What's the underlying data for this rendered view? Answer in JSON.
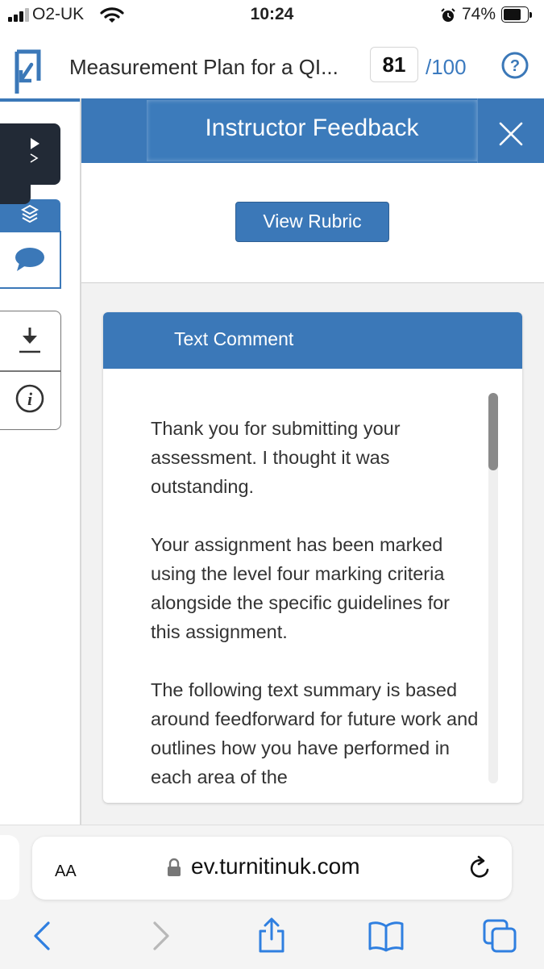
{
  "status_bar": {
    "carrier": "O2-UK",
    "time": "10:24",
    "battery_percent": "74%",
    "battery_level": 0.74,
    "icons": [
      "signal-icon",
      "wifi-icon",
      "alarm-icon",
      "battery-icon"
    ]
  },
  "header": {
    "title": "Measurement Plan for a QI...",
    "score": "81",
    "score_max": "/100",
    "icons": [
      "turnitin-logo-icon",
      "help-icon"
    ]
  },
  "sidebar": {
    "icons": [
      "panel-toggle-icon",
      "layers-icon",
      "comment-bubble-icon",
      "download-icon",
      "info-icon"
    ]
  },
  "feedback_panel": {
    "title": "Instructor Feedback",
    "rubric_button": "View Rubric",
    "comment_header": "Text Comment",
    "comment_paragraphs": [
      "Thank you for submitting your assessment. I thought it was outstanding.",
      "Your assignment has been marked using the level four marking criteria alongside the specific guidelines for this assignment.",
      "The following text summary is based around feedforward for future work and outlines how you have performed in each area of the"
    ]
  },
  "browser": {
    "reader_button": "AA",
    "url": "ev.turnitinuk.com",
    "icons": [
      "lock-icon",
      "reload-icon",
      "back-icon",
      "forward-icon",
      "share-icon",
      "bookmarks-icon",
      "tabs-icon"
    ]
  },
  "colors": {
    "accent": "#3b78b8",
    "score_max": "#3b7abf",
    "dark_tab": "#222a36",
    "safari_blue": "#2f7fe0",
    "disabled": "#b8b8b8"
  }
}
